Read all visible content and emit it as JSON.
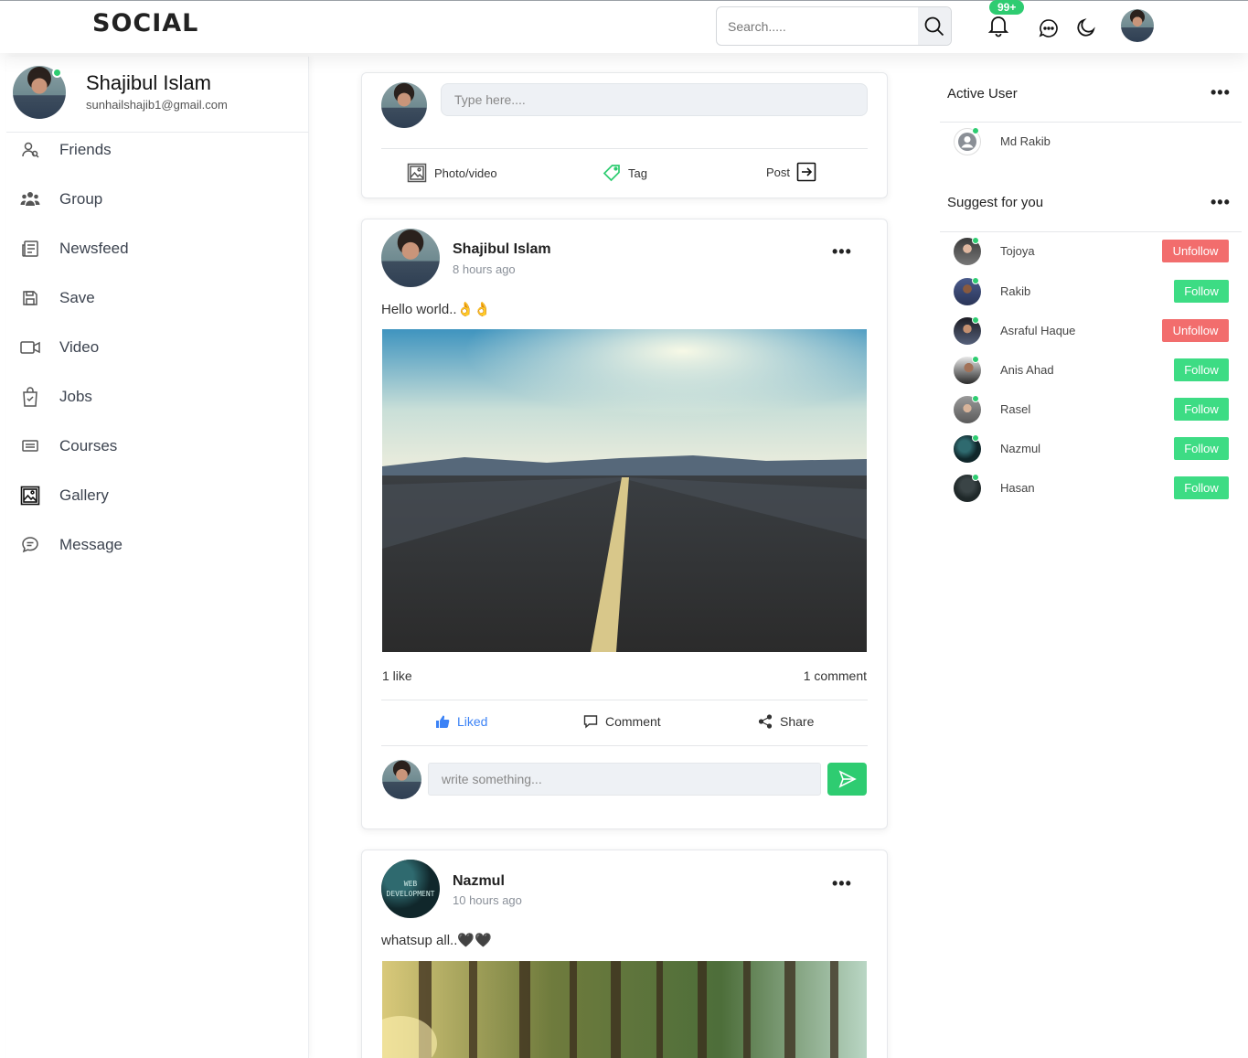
{
  "header": {
    "logo": "SOCIAL",
    "search_placeholder": "Search.....",
    "notification_count": "99+",
    "icons": [
      "search-icon",
      "bell-icon",
      "chat-icon",
      "moon-icon",
      "avatar"
    ]
  },
  "profile": {
    "name": "Shajibul Islam",
    "email": "sunhailshajib1@gmail.com",
    "online": true
  },
  "sidebar": {
    "items": [
      {
        "label": "Friends",
        "icon": "friends-icon"
      },
      {
        "label": "Group",
        "icon": "group-icon"
      },
      {
        "label": "Newsfeed",
        "icon": "newsfeed-icon"
      },
      {
        "label": "Save",
        "icon": "save-icon"
      },
      {
        "label": "Video",
        "icon": "video-icon"
      },
      {
        "label": "Jobs",
        "icon": "jobs-icon"
      },
      {
        "label": "Courses",
        "icon": "courses-icon"
      },
      {
        "label": "Gallery",
        "icon": "gallery-icon"
      },
      {
        "label": "Message",
        "icon": "message-icon"
      }
    ]
  },
  "composer": {
    "placeholder": "Type here....",
    "photo_label": "Photo/video",
    "tag_label": "Tag",
    "post_label": "Post"
  },
  "posts": [
    {
      "author": "Shajibul Islam",
      "time": "8 hours ago",
      "text": "Hello world..👌👌",
      "likes": "1 like",
      "comments": "1 comment",
      "liked_label": "Liked",
      "comment_label": "Comment",
      "share_label": "Share",
      "comment_placeholder": "write something...",
      "image": "road-photo"
    },
    {
      "author": "Nazmul",
      "time": "10 hours ago",
      "text": "whatsup all..🖤🖤",
      "avatar_text": "WEB DEVELOPMENT",
      "image": "forest-photo"
    }
  ],
  "right": {
    "active_title": "Active User",
    "active_users": [
      {
        "name": "Md Rakib"
      }
    ],
    "suggest_title": "Suggest for you",
    "suggestions": [
      {
        "name": "Tojoya",
        "action": "Unfollow"
      },
      {
        "name": "Rakib",
        "action": "Follow"
      },
      {
        "name": "Asraful Haque",
        "action": "Unfollow"
      },
      {
        "name": "Anis Ahad",
        "action": "Follow"
      },
      {
        "name": "Rasel",
        "action": "Follow"
      },
      {
        "name": "Nazmul",
        "action": "Follow"
      },
      {
        "name": "Hasan",
        "action": "Follow"
      }
    ]
  },
  "colors": {
    "accent_green": "#2ecc71",
    "unfollow_red": "#f26d6d",
    "liked_blue": "#3b82f6"
  }
}
